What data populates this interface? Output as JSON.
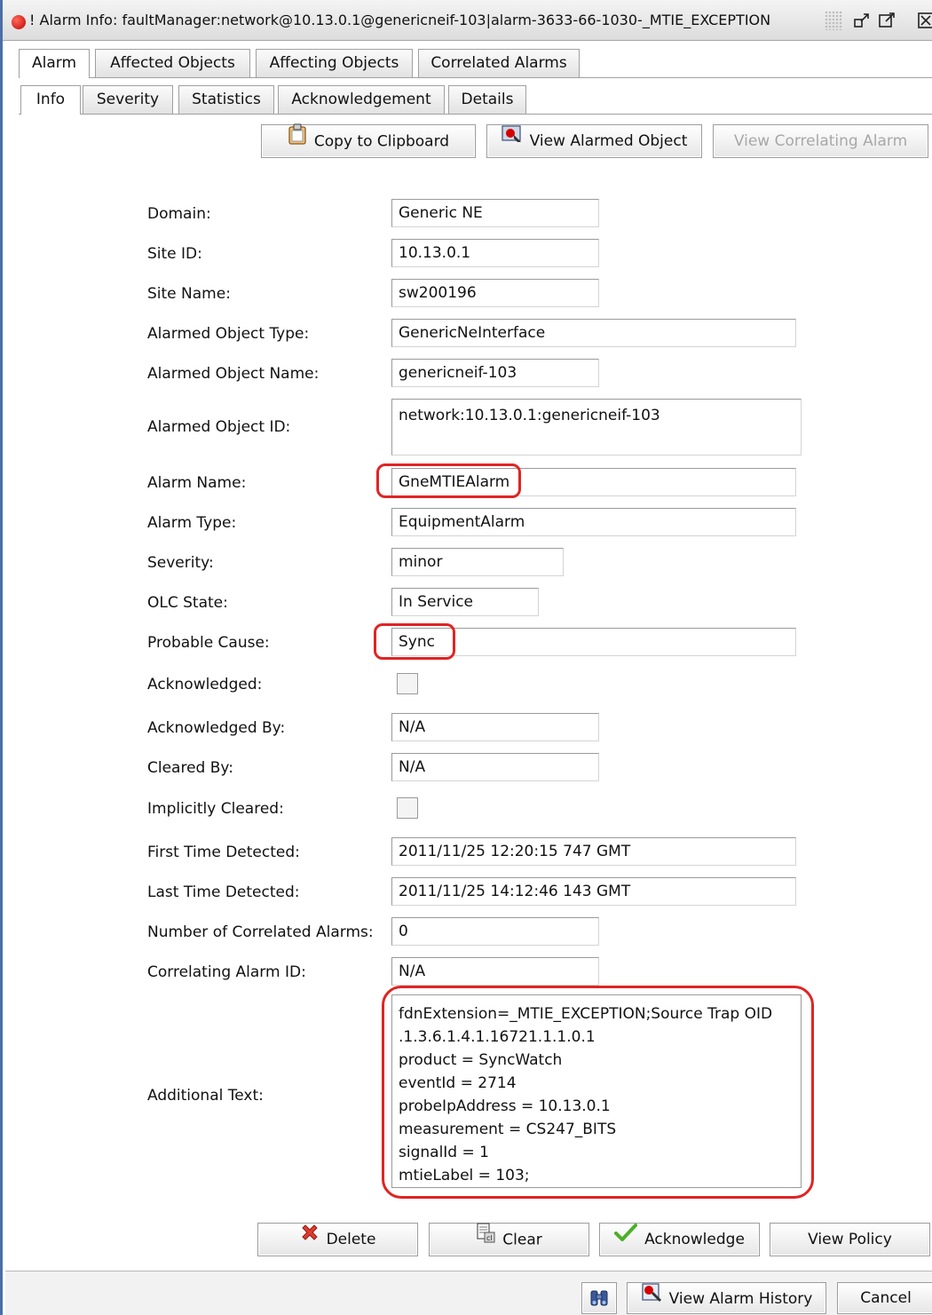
{
  "window": {
    "title": "Alarm Info: faultManager:network@10.13.0.1@genericneif-103|alarm-3633-66-1030-_MTIE_EXCEPTION",
    "title_prefix": "!",
    "minimize_glyph": "↗",
    "maximize_glyph": "☐",
    "close_glyph": "☒"
  },
  "main_tabs": [
    {
      "label": "Alarm",
      "active": true
    },
    {
      "label": "Affected Objects",
      "active": false
    },
    {
      "label": "Affecting Objects",
      "active": false
    },
    {
      "label": "Correlated Alarms",
      "active": false
    }
  ],
  "sub_tabs": [
    {
      "label": "Info",
      "active": true
    },
    {
      "label": "Severity",
      "active": false
    },
    {
      "label": "Statistics",
      "active": false
    },
    {
      "label": "Acknowledgement",
      "active": false
    },
    {
      "label": "Details",
      "active": false
    }
  ],
  "toolbar": {
    "copy": "Copy to Clipboard",
    "view_alarmed": "View Alarmed Object",
    "view_correlating": "View Correlating Alarm"
  },
  "fields": {
    "domain": {
      "label": "Domain:",
      "value": "Generic NE"
    },
    "site_id": {
      "label": "Site ID:",
      "value": "10.13.0.1"
    },
    "site_name": {
      "label": "Site Name:",
      "value": "sw200196"
    },
    "object_type": {
      "label": "Alarmed Object Type:",
      "value": "GenericNeInterface"
    },
    "object_name": {
      "label": "Alarmed Object Name:",
      "value": "genericneif-103"
    },
    "object_id": {
      "label": "Alarmed Object ID:",
      "value": "network:10.13.0.1:genericneif-103"
    },
    "alarm_name": {
      "label": "Alarm Name:",
      "value": "GneMTIEAlarm"
    },
    "alarm_type": {
      "label": "Alarm Type:",
      "value": "EquipmentAlarm"
    },
    "severity": {
      "label": "Severity:",
      "value": "minor"
    },
    "olc_state": {
      "label": "OLC State:",
      "value": "In Service"
    },
    "probable_cause": {
      "label": "Probable Cause:",
      "value": "Sync"
    },
    "acknowledged": {
      "label": "Acknowledged:",
      "checked": false
    },
    "acknowledged_by": {
      "label": "Acknowledged By:",
      "value": "N/A"
    },
    "cleared_by": {
      "label": "Cleared By:",
      "value": "N/A"
    },
    "implicitly_cleared": {
      "label": "Implicitly Cleared:",
      "checked": false
    },
    "first_detected": {
      "label": "First Time Detected:",
      "value": "2011/11/25 12:20:15 747 GMT"
    },
    "last_detected": {
      "label": "Last Time Detected:",
      "value": "2011/11/25 14:12:46 143 GMT"
    },
    "num_correlated": {
      "label": "Number of Correlated Alarms:",
      "value": "0"
    },
    "correlating_id": {
      "label": "Correlating Alarm ID:",
      "value": "N/A"
    },
    "additional_text": {
      "label": "Additional Text:",
      "lines": [
        "fdnExtension=_MTIE_EXCEPTION;Source Trap OID",
        ".1.3.6.1.4.1.16721.1.1.0.1",
        "product = SyncWatch",
        "eventId = 2714",
        "probeIpAddress = 10.13.0.1",
        "measurement = CS247_BITS",
        "signalId = 1",
        "mtieLabel = 103;"
      ]
    }
  },
  "actions": {
    "delete": "Delete",
    "clear": "Clear",
    "acknowledge": "Acknowledge",
    "view_policy": "View Policy"
  },
  "footer": {
    "view_history": "View Alarm History",
    "cancel": "Cancel"
  },
  "colors": {
    "highlight": "#e02424",
    "window_border": "#4a6ea9",
    "alarm_icon": "#d40000"
  }
}
